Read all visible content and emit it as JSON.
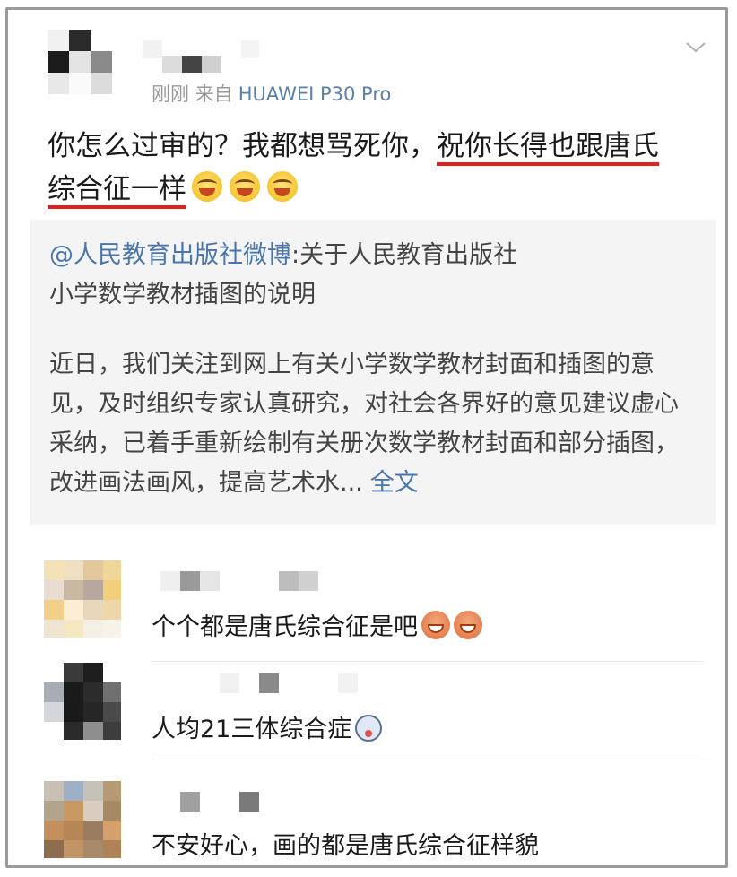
{
  "post": {
    "time": "刚刚",
    "source_prefix": "来自",
    "device": "HUAWEI P30 Pro",
    "text_plain": "你怎么过审的？我都想骂死你，",
    "text_highlight_1": "祝你长得也跟唐氏",
    "text_highlight_2": "综合征一样",
    "emoji_icon": "grinning-sweat-emoji"
  },
  "repost": {
    "mention": "@人民教育出版社微博",
    "title_rest": ":关于人民教育出版社",
    "title_line2": "小学数学教材插图的说明",
    "body": "近日，我们关注到网上有关小学数学教材封面和插图的意见，及时组织专家认真研究，对社会各界好的意见建议虚心采纳，已着手重新绘制有关册次数学教材封面和部分插图，改进画法画风，提高艺术水...",
    "fulltext_label": "全文"
  },
  "comments": [
    {
      "text": "个个都是唐氏综合征是吧",
      "emoji": "laughing-emoji"
    },
    {
      "text": "人均21三体综合症",
      "emoji": "shocked-face-emoji"
    },
    {
      "text": "不安好心，画的都是唐氏综合征样貌"
    }
  ],
  "colors": {
    "link": "#4a76ac",
    "highlight_underline": "#e02020",
    "meta_gray": "#9a9a9a",
    "repost_bg": "#f4f4f4"
  }
}
